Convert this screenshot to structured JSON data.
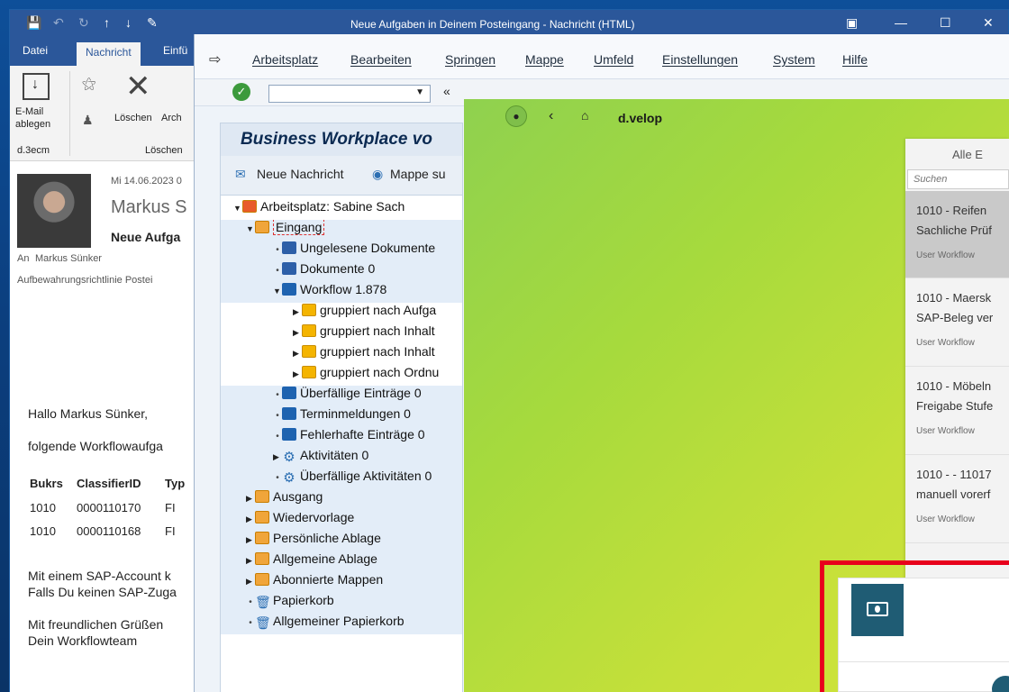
{
  "outlook": {
    "title": "Neue Aufgaben in Deinem Posteingang  -  Nachricht (HTML)",
    "tabs": [
      "Datei",
      "Nachricht",
      "Einfü"
    ],
    "ribbon": {
      "email_ablegen": "E-Mail ablegen",
      "d3ecm": "d.3ecm",
      "loeschen": "Löschen",
      "archiv": "Arch",
      "group_loeschen": "Löschen"
    },
    "message": {
      "date": "Mi 14.06.2023 0",
      "sender": "Markus S",
      "subject": "Neue Aufga",
      "to_label": "An",
      "to": "Markus Sünker",
      "categories": "Aufbewahrungsrichtlinie   Postei",
      "greeting": "Hallo Markus Sünker,",
      "intro": "folgende Workflowaufga",
      "table": {
        "headers": [
          "Bukrs",
          "ClassifierID",
          "Typ"
        ],
        "rows": [
          [
            "1010",
            "0000110170",
            "FI"
          ],
          [
            "1010",
            "0000110168",
            "FI"
          ]
        ]
      },
      "para1_line1": "Mit einem SAP-Account k",
      "para1_line2": "Falls Du keinen SAP-Zuga",
      "closing1": "Mit freundlichen Grüßen",
      "closing2": "Dein Workflowteam"
    }
  },
  "sap": {
    "menu": [
      "Arbeitsplatz",
      "Bearbeiten",
      "Springen",
      "Mappe",
      "Umfeld",
      "Einstellungen",
      "System",
      "Hilfe"
    ],
    "title": "Business Workplace vo",
    "toolbar": {
      "new_message": "Neue Nachricht",
      "find_folder": "Mappe su"
    },
    "tree": [
      {
        "label": "Arbeitsplatz: Sabine Sach"
      },
      {
        "label": "Eingang"
      },
      {
        "label": "Ungelesene Dokumente"
      },
      {
        "label": "Dokumente 0"
      },
      {
        "label": "Workflow 1.878"
      },
      {
        "label": "gruppiert nach Aufga"
      },
      {
        "label": "gruppiert nach Inhalt"
      },
      {
        "label": "gruppiert nach Inhalt"
      },
      {
        "label": "gruppiert nach Ordnu"
      },
      {
        "label": "Überfällige Einträge 0"
      },
      {
        "label": "Terminmeldungen 0"
      },
      {
        "label": "Fehlerhafte Einträge 0"
      },
      {
        "label": "Aktivitäten 0"
      },
      {
        "label": "Überfällige Aktivitäten 0"
      },
      {
        "label": "Ausgang"
      },
      {
        "label": "Wiedervorlage"
      },
      {
        "label": "Persönliche Ablage"
      },
      {
        "label": "Allgemeine Ablage"
      },
      {
        "label": "Abonnierte Mappen"
      },
      {
        "label": "Papierkorb"
      },
      {
        "label": "Allgemeiner Papierkorb"
      }
    ]
  },
  "dvelop": {
    "brand": "d.velop",
    "list_header": "Alle E",
    "search_placeholder": "Suchen",
    "items": [
      {
        "line1": "1010 - Reifen",
        "line2": "Sachliche Prüf",
        "sub": "User Workflow"
      },
      {
        "line1": "1010 - Maersk",
        "line2": "SAP-Beleg ver",
        "sub": "User Workflow"
      },
      {
        "line1": "1010 - Möbeln",
        "line2": "Freigabe Stufe",
        "sub": "User Workflow"
      },
      {
        "line1": "1010 - - 11017",
        "line2": "manuell vorerf",
        "sub": "User Workflow"
      }
    ]
  },
  "colors": {
    "outlook_blue": "#2b579a",
    "sap_title": "#0b2a52",
    "dvelop_green": "#a6da3d",
    "highlight_red": "#e8001c",
    "money_tile": "#1f5c74"
  }
}
